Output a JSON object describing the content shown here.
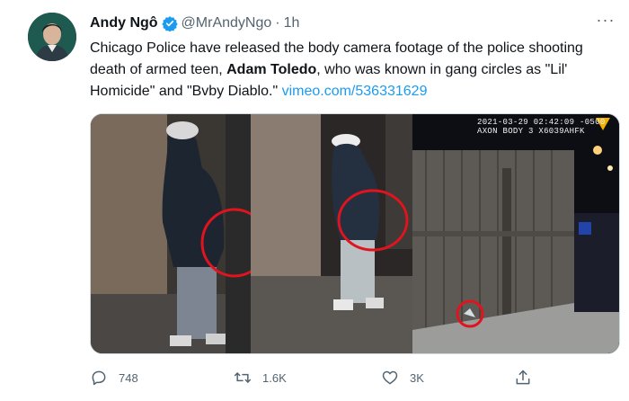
{
  "tweet": {
    "display_name": "Andy Ngô",
    "handle": "@MrAndyNgo",
    "separator": "·",
    "time": "1h",
    "more_label": "···",
    "text_part1": "Chicago Police have released the body camera footage of the police shooting death of armed teen, ",
    "text_bold": "Adam Toledo",
    "text_part2": ", who was known in gang circles as \"Lil' Homicide\" and \"Bvby Diablo.\" ",
    "link_text": "vimeo.com/536331629",
    "media": {
      "timestamp_line": "2021-03-29 02:42:09 -0500",
      "device_line": "AXON BODY 3 X6039AHFK"
    },
    "actions": {
      "reply_count": "748",
      "retweet_count": "1.6K",
      "like_count": "3K"
    }
  },
  "icons": [
    "verified-badge-icon",
    "more-options-icon",
    "reply-icon",
    "retweet-icon",
    "like-icon",
    "share-icon"
  ],
  "colors": {
    "link": "#1d9bf0",
    "secondary_text": "#536471",
    "highlight_circle": "#e0141e",
    "verified": "#1d9bf0"
  }
}
